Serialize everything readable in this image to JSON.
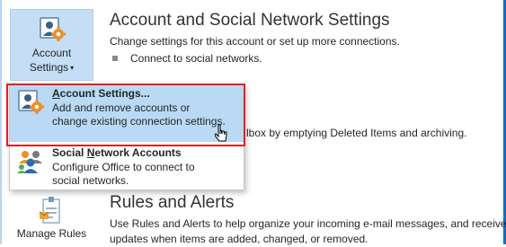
{
  "colors": {
    "accent": "#0f6fc6",
    "selected_bg": "#c5def5",
    "menu_hover_bg": "#b9d9f5",
    "highlight_box": "#e02020"
  },
  "account_button": {
    "line1": "Account",
    "line2": "Settings",
    "caret": "▾",
    "icon": "account-settings-icon"
  },
  "account_section": {
    "title": "Account and Social Network Settings",
    "description": "Change settings for this account or set up more connections.",
    "bullet": "Connect to social networks."
  },
  "mailbox_section": {
    "fragment": "lbox by emptying Deleted Items and archiving."
  },
  "menu": {
    "items": [
      {
        "title_underline": "A",
        "title_rest": "ccount Settings...",
        "desc_line1": "Add and remove accounts or",
        "desc_line2": "change existing connection settings.",
        "icon": "account-settings-icon"
      },
      {
        "title_pre": "Social ",
        "title_underline": "N",
        "title_rest": "etwork Accounts",
        "desc_line1": "Configure Office to connect to",
        "desc_line2": "social networks.",
        "icon": "social-network-icon"
      }
    ]
  },
  "rules_button": {
    "label": "Manage Rules",
    "icon": "manage-rules-icon"
  },
  "rules_section": {
    "title": "Rules and Alerts",
    "line1": "Use Rules and Alerts to help organize your incoming e-mail messages, and receive",
    "line2": "updates when items are added, changed, or removed."
  }
}
